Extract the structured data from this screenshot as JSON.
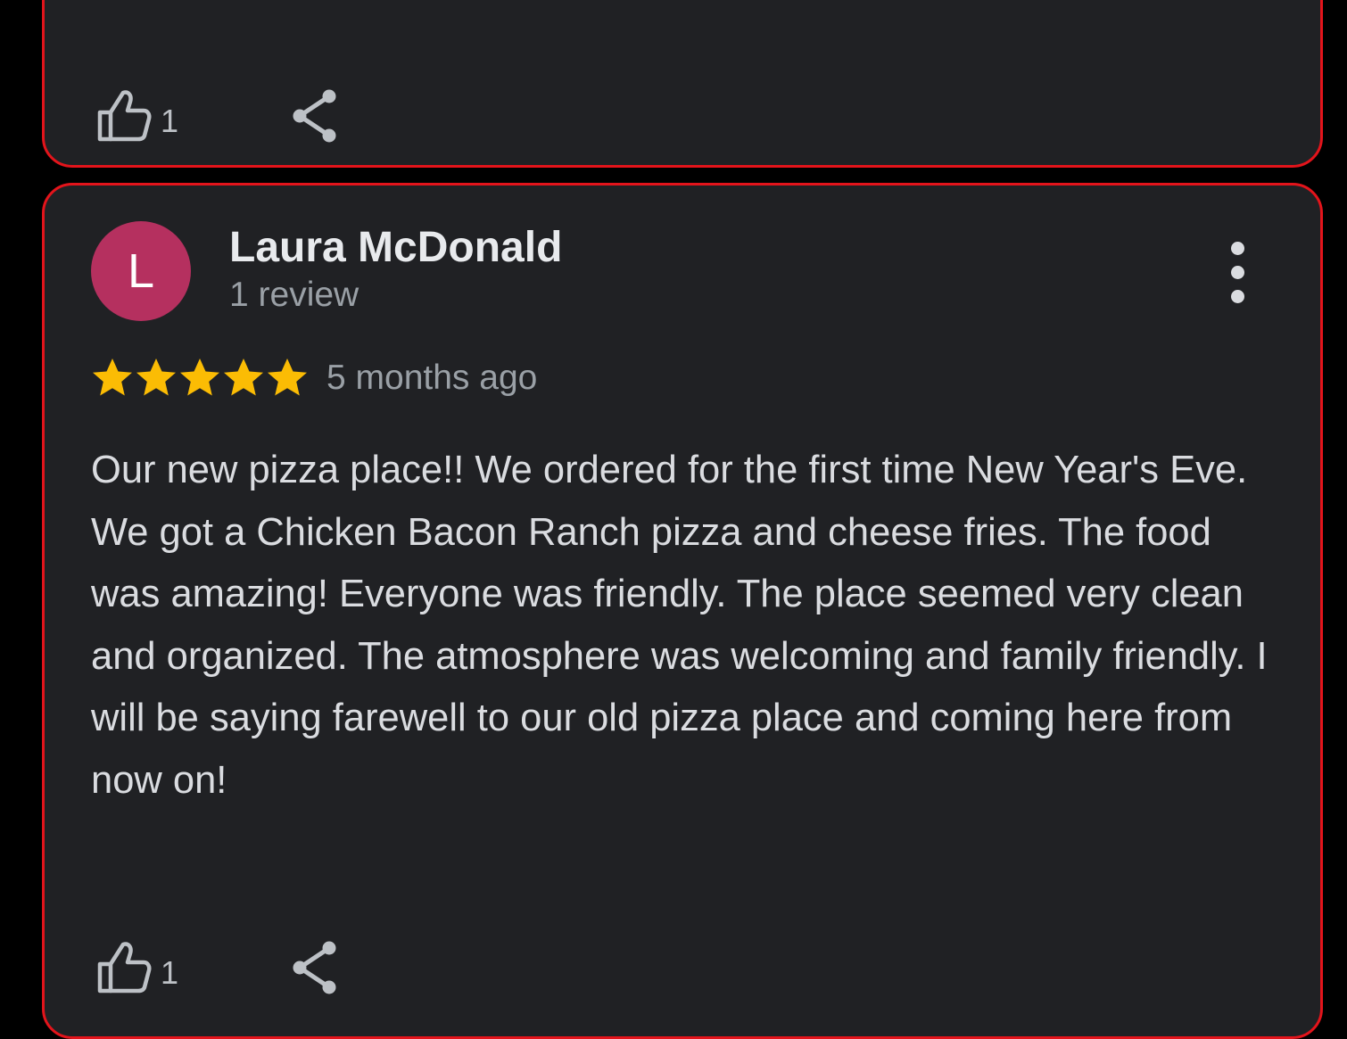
{
  "colors": {
    "background": "#000000",
    "card_background": "#202124",
    "card_border": "#e3141b",
    "avatar_background": "#b5305f",
    "star": "#fbbc04",
    "primary_text": "#e8eaed",
    "secondary_text": "#9aa0a6",
    "body_text": "#dadce0",
    "icon": "#bdc1c6"
  },
  "previous_review": {
    "actions": {
      "like_icon": "thumbs-up-outline",
      "like_count": "1",
      "share_icon": "share"
    }
  },
  "review": {
    "avatar_initial": "L",
    "reviewer_name": "Laura McDonald",
    "review_count": "1 review",
    "more_icon": "more-vertical",
    "rating": 5,
    "rating_max": 5,
    "date": "5 months ago",
    "text": "Our new pizza place!! We ordered for the first time New Year's Eve. We got a Chicken Bacon Ranch pizza and cheese fries. The food was amazing! Everyone was friendly. The place seemed very clean and organized. The atmosphere was welcoming and family friendly. I will be saying farewell to our old pizza place and coming here from now on!",
    "actions": {
      "like_icon": "thumbs-up-outline",
      "like_count": "1",
      "share_icon": "share"
    }
  }
}
